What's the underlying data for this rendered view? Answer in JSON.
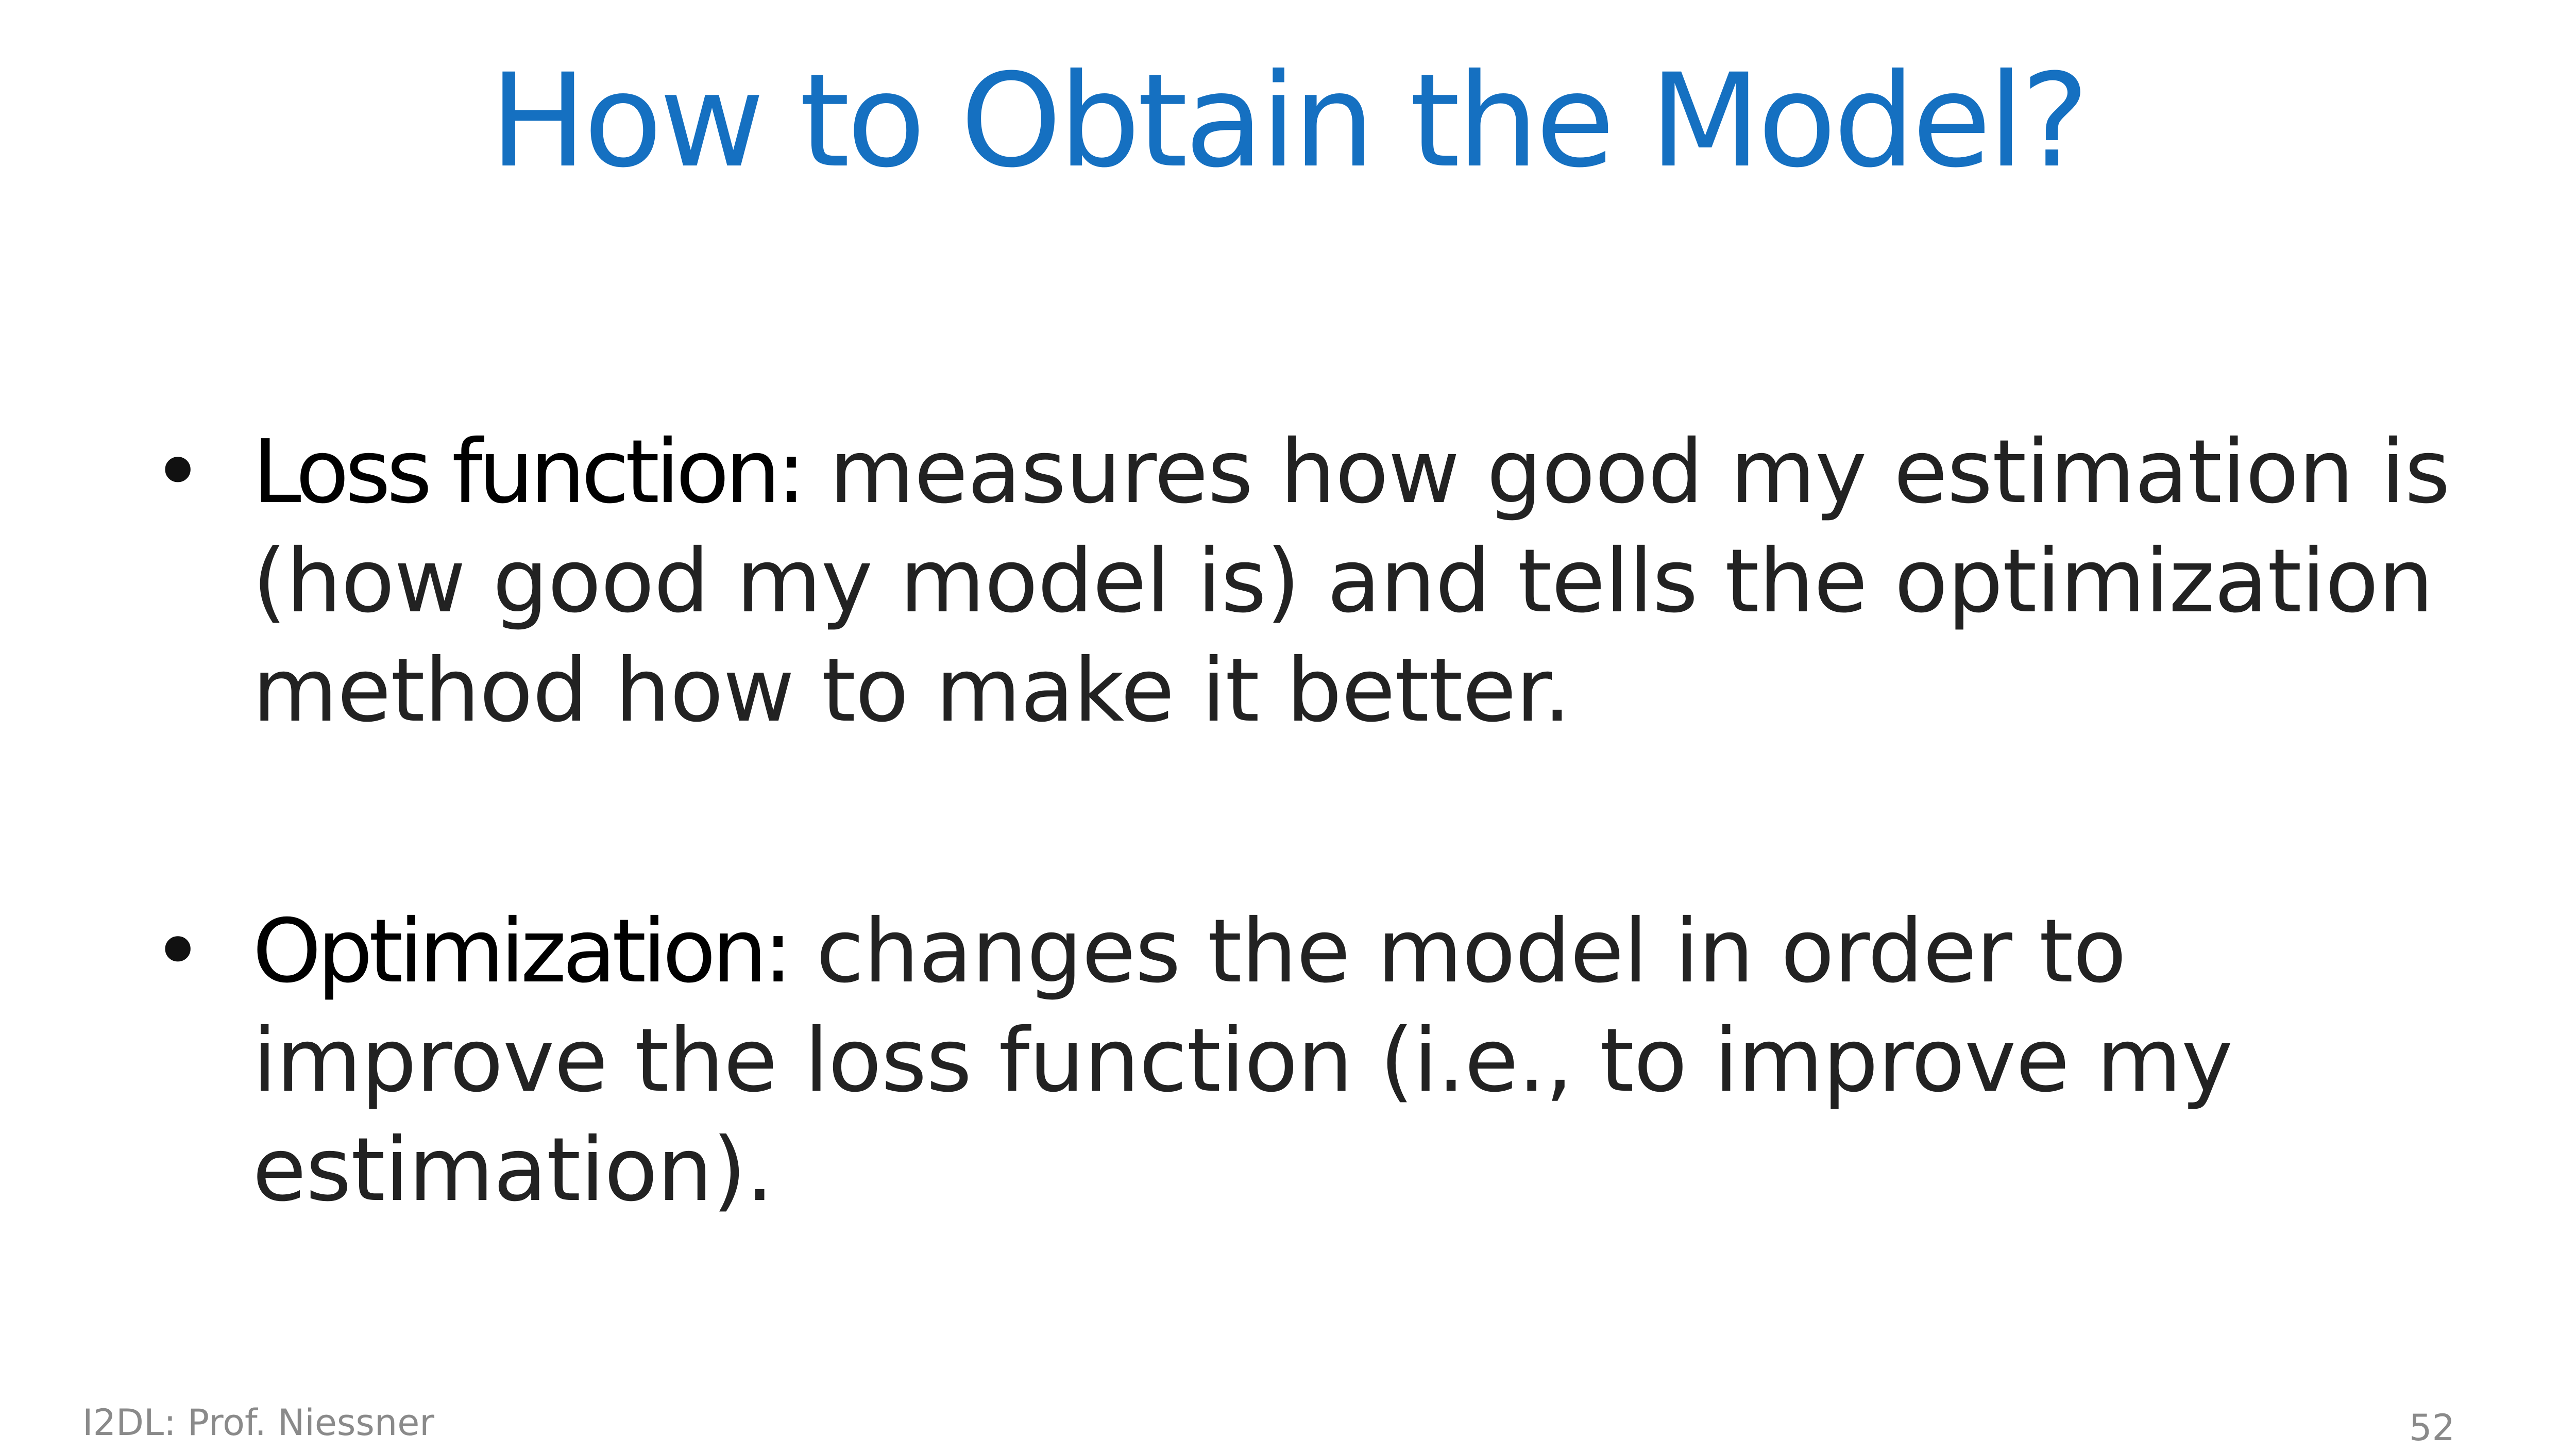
{
  "slide": {
    "title": "How to Obtain the Model?",
    "bullets": [
      {
        "term": "Loss function:",
        "text": " measures how good my estimation is (how good my model is) and tells the optimization method how to make it better."
      },
      {
        "term": "Optimization:",
        "text": " changes the model in order to improve the loss function (i.e., to improve my estimation)."
      }
    ],
    "bullet_symbol": "•",
    "footer": {
      "left": "I2DL: Prof. Niessner",
      "page_number": "52"
    }
  },
  "colors": {
    "title": "#1570c1",
    "text": "#222222",
    "footer": "#8a8a8a",
    "background": "#ffffff"
  }
}
